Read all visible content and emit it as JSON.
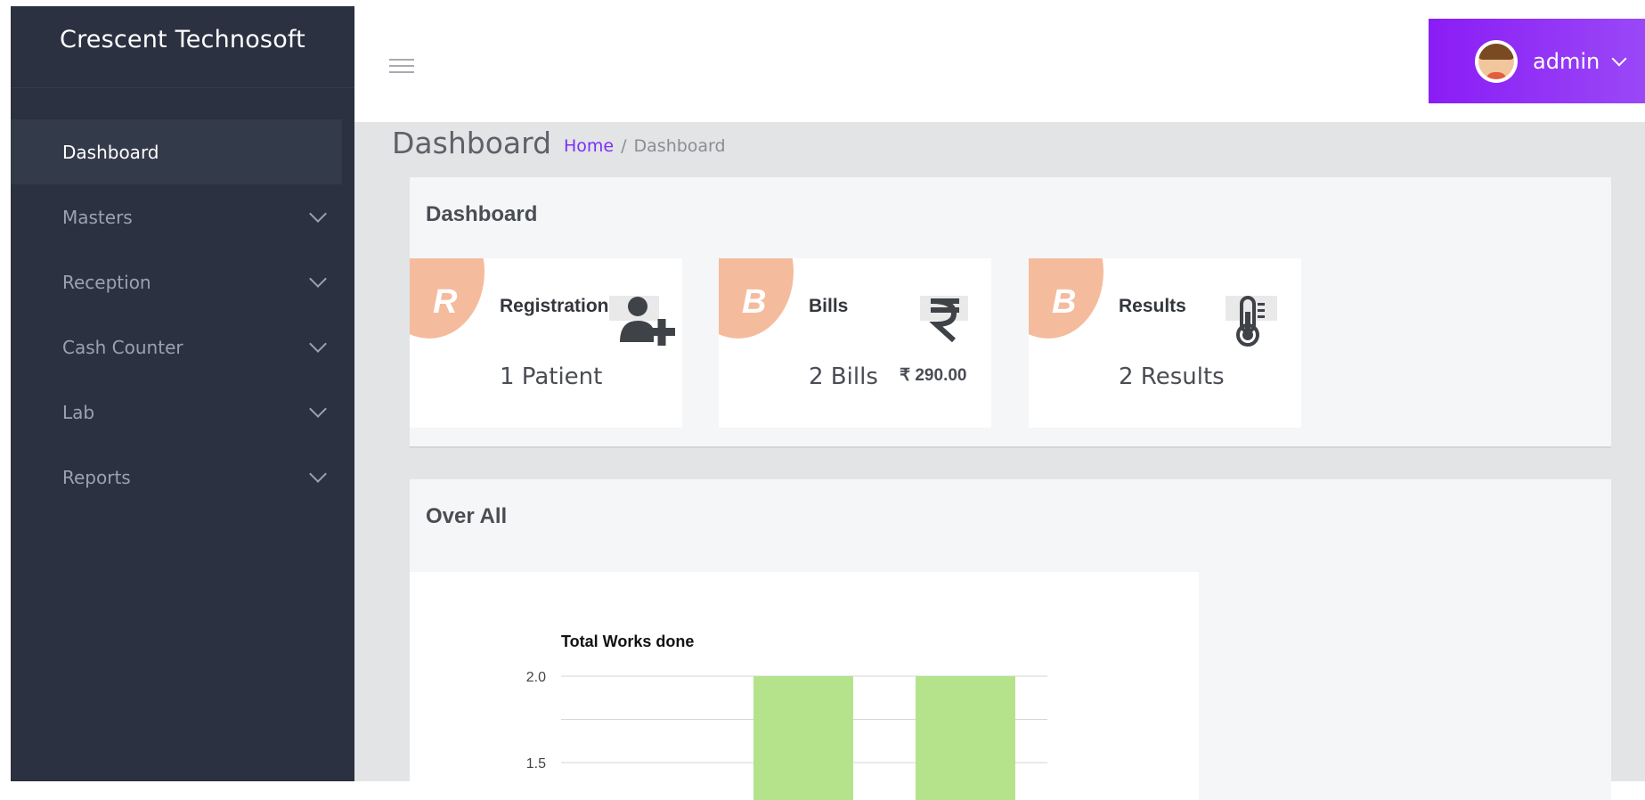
{
  "brand": {
    "name": "Crescent Technosoft"
  },
  "sidebar": {
    "items": [
      {
        "label": "Dashboard",
        "active": true
      },
      {
        "label": "Masters"
      },
      {
        "label": "Reception"
      },
      {
        "label": "Cash Counter"
      },
      {
        "label": "Lab"
      },
      {
        "label": "Reports"
      }
    ]
  },
  "header": {
    "user": "admin"
  },
  "page": {
    "title": "Dashboard",
    "breadcrumb": {
      "home": "Home",
      "separator": "/",
      "current": "Dashboard"
    }
  },
  "dashboard_panel": {
    "title": "Dashboard",
    "cards": [
      {
        "letter": "R",
        "title": "Registrations",
        "value": "1 Patient",
        "icon": "add-user-icon"
      },
      {
        "letter": "B",
        "title": "Bills",
        "value": "2 Bills",
        "amount": "₹ 290.00",
        "icon": "rupee-icon"
      },
      {
        "letter": "B",
        "title": "Results",
        "value": "2 Results",
        "icon": "thermometer-icon"
      }
    ]
  },
  "overall_panel": {
    "title": "Over All"
  },
  "colors": {
    "accent": "#8a1cf5",
    "sidebar": "#2b3140",
    "blob": "#f5bb9d",
    "bar": "#b5e38c"
  },
  "chart_data": {
    "type": "bar",
    "title": "Total Works done",
    "y_ticks": [
      "2.0",
      "1.5"
    ],
    "values": [
      2,
      2
    ],
    "ylim_visible": [
      1.5,
      2.0
    ]
  }
}
